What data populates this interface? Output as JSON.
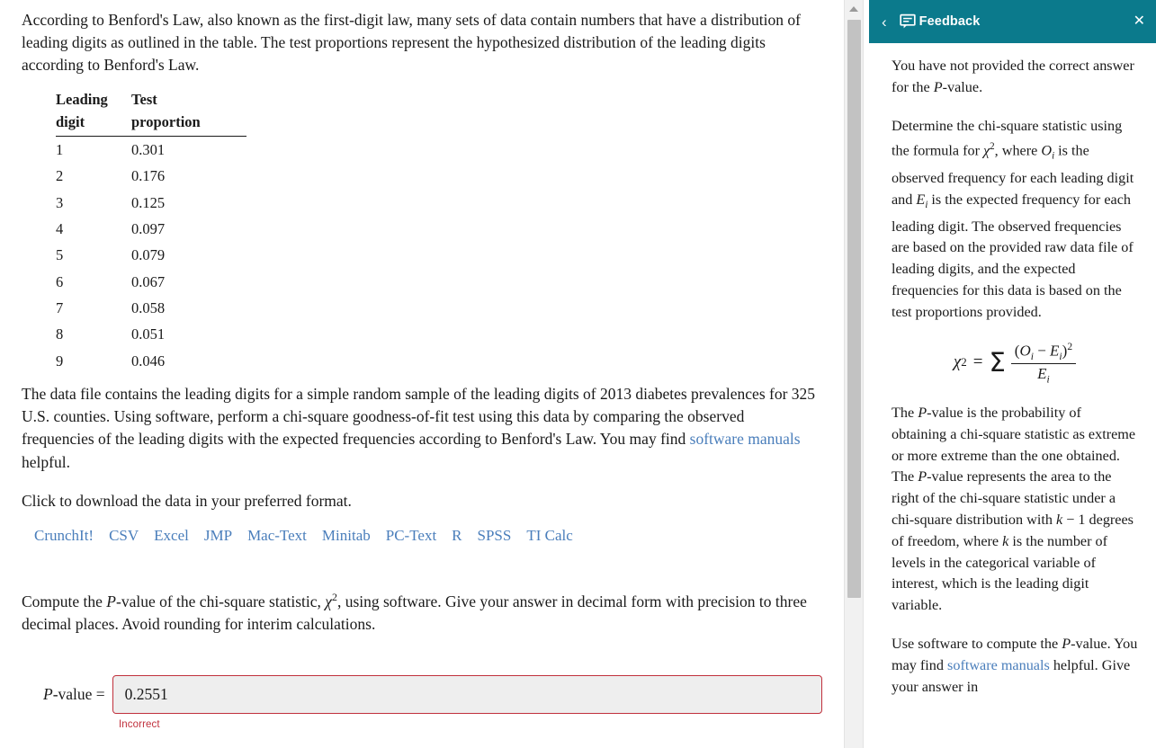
{
  "question": {
    "intro_paragraph": "According to Benford's Law, also known as the first-digit law, many sets of data contain numbers that have a distribution of leading digits as outlined in the table. The test proportions represent the hypothesized distribution of the leading digits according to Benford's Law.",
    "table": {
      "header_digit_line1": "Leading",
      "header_digit_line2": "digit",
      "header_prop_line1": "Test",
      "header_prop_line2": "proportion",
      "rows": [
        {
          "digit": "1",
          "proportion": "0.301"
        },
        {
          "digit": "2",
          "proportion": "0.176"
        },
        {
          "digit": "3",
          "proportion": "0.125"
        },
        {
          "digit": "4",
          "proportion": "0.097"
        },
        {
          "digit": "5",
          "proportion": "0.079"
        },
        {
          "digit": "6",
          "proportion": "0.067"
        },
        {
          "digit": "7",
          "proportion": "0.058"
        },
        {
          "digit": "8",
          "proportion": "0.051"
        },
        {
          "digit": "9",
          "proportion": "0.046"
        }
      ]
    },
    "data_paragraph_part1": "The data file contains the leading digits for a simple random sample of the leading digits of 2013 diabetes prevalences for 325 U.S. counties. Using software, perform a chi-square goodness-of-fit test using this data by comparing the observed frequencies of the leading digits with the expected frequencies according to Benford's Law. You may find ",
    "data_paragraph_link": "software manuals",
    "data_paragraph_part2": " helpful.",
    "download_prompt": "Click to download the data in your preferred format.",
    "download_links": [
      "CrunchIt!",
      "CSV",
      "Excel",
      "JMP",
      "Mac-Text",
      "Minitab",
      "PC-Text",
      "R",
      "SPSS",
      "TI Calc"
    ],
    "compute_prompt_part1": "Compute the ",
    "compute_prompt_P": "P",
    "compute_prompt_part2": "-value of the chi-square statistic, ",
    "compute_prompt_chi": "χ",
    "compute_prompt_sup": "2",
    "compute_prompt_part3": ", using software. Give your answer in decimal form with precision to three decimal places. Avoid rounding for interim calculations."
  },
  "answer": {
    "label_P": "P",
    "label_rest": "-value =",
    "value": "0.2551",
    "placeholder": "",
    "status": "Incorrect",
    "status_color": "#c0303c",
    "border_color": "#c0303c"
  },
  "feedback": {
    "title": "Feedback",
    "back_icon": "chevron-left-icon",
    "panel_icon": "speech-bubble-icon",
    "close_icon": "close-icon",
    "header_color": "#0b7a8c",
    "paragraphs": {
      "p1_part1": "You have not provided the correct answer for the ",
      "p1_P": "P",
      "p1_part2": "-value.",
      "p2_part1": "Determine the chi-square statistic using the formula for ",
      "p2_chi": "χ",
      "p2_sup": "2",
      "p2_part2": ", where ",
      "p2_O": "O",
      "p2_Osub": "i",
      "p2_part3": " is the observed frequency for each leading digit and ",
      "p2_E": "E",
      "p2_Esub": "i",
      "p2_part4": " is the expected frequency for each leading digit. The observed frequencies are based on the provided raw data file of leading digits, and the expected frequencies for this data is based on the test proportions provided.",
      "p3_part1": "The ",
      "p3_P1": "P",
      "p3_part2": "-value is the probability of obtaining a chi-square statistic as extreme or more extreme than the one obtained. The ",
      "p3_P2": "P",
      "p3_part3": "-value represents the area to the right of the chi-square statistic under a chi-square distribution with ",
      "p3_k1": "k",
      "p3_part4": " − 1 degrees of freedom, where ",
      "p3_k2": "k",
      "p3_part5": " is the number of levels in the categorical variable of interest, which is the leading digit variable.",
      "p4_part1": "Use software to compute the ",
      "p4_P": "P",
      "p4_part2": "-value. You may find ",
      "p4_link": "software manuals",
      "p4_part3": " helpful. Give your answer in"
    },
    "formula": {
      "chi": "χ",
      "chi_sup": "2",
      "equals": "=",
      "sigma": "Σ",
      "numerator_open": "(",
      "numerator_O": "O",
      "numerator_Osub": "i",
      "numerator_minus": " − ",
      "numerator_E": "E",
      "numerator_Esub": "i",
      "numerator_close": ")",
      "numerator_sup": "2",
      "denominator_E": "E",
      "denominator_Esub": "i"
    }
  },
  "scrollbar": {
    "up_arrow_icon": "triangle-up-icon"
  }
}
